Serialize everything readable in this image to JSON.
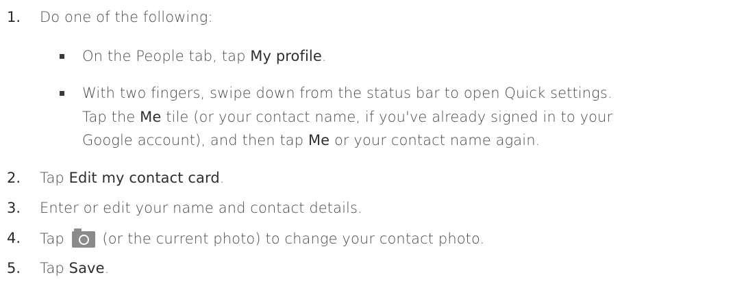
{
  "steps": [
    {
      "number": "1.",
      "text": "Do one of the following:",
      "bullets": [
        {
          "pre": "On the People tab, tap ",
          "ui": "My profile",
          "post": "."
        },
        {
          "line1": "With two fingers, swipe down from the status bar to open Quick settings.",
          "line2_pre": "Tap the ",
          "line2_ui": "Me",
          "line2_post": " tile (or your contact name, if you've already signed in to your",
          "line3_pre": "Google account), and then tap ",
          "line3_ui": "Me",
          "line3_post": " or your contact name again."
        }
      ]
    },
    {
      "number": "2.",
      "pre": "Tap ",
      "ui": "Edit my contact card",
      "post": "."
    },
    {
      "number": "3.",
      "text": "Enter or edit your name and contact details."
    },
    {
      "number": "4.",
      "pre": "Tap ",
      "icon": "camera-icon",
      "post": " (or the current photo) to change your contact photo."
    },
    {
      "number": "5.",
      "pre": "Tap ",
      "ui": "Save",
      "post": "."
    }
  ],
  "colors": {
    "text": "#4a4a4a",
    "ui_emphasis": "#2e2e2e",
    "icon": "#8a8a8a"
  }
}
